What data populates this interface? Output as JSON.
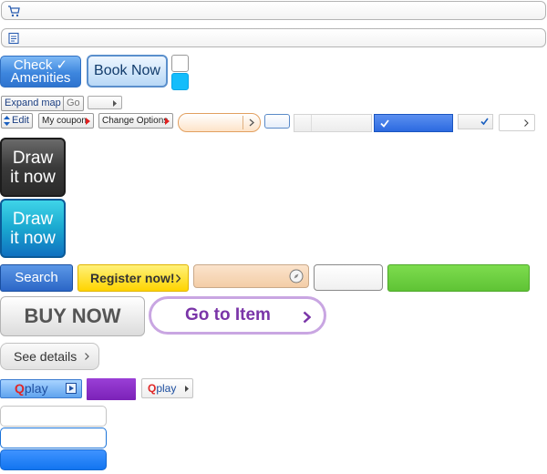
{
  "buttons": {
    "check_amenities_line1": "Check ✓",
    "check_amenities_line2": "Amenities",
    "book_now": "Book Now",
    "expand_map": "Expand map",
    "go": "Go",
    "edit": "Edit",
    "my_coupon": "My coupon",
    "change_options": "Change Options",
    "draw_line1": "Draw",
    "draw_line2": "it now",
    "search": "Search",
    "register_now": "Register now!",
    "buy_now": "BUY NOW",
    "go_to_item": "Go to Item",
    "see_details": "See details",
    "qplay_q": "Q",
    "qplay_play": "play"
  },
  "colors": {
    "accent_blue": "#2f74cf",
    "green": "#5fc335",
    "purple": "#7b22b8",
    "cyan": "#14bdfb"
  },
  "icons": {
    "cart": "cart-icon",
    "note": "note-icon",
    "compass": "compass-icon",
    "check": "check-icon",
    "chevron": "chevron-right-icon"
  }
}
